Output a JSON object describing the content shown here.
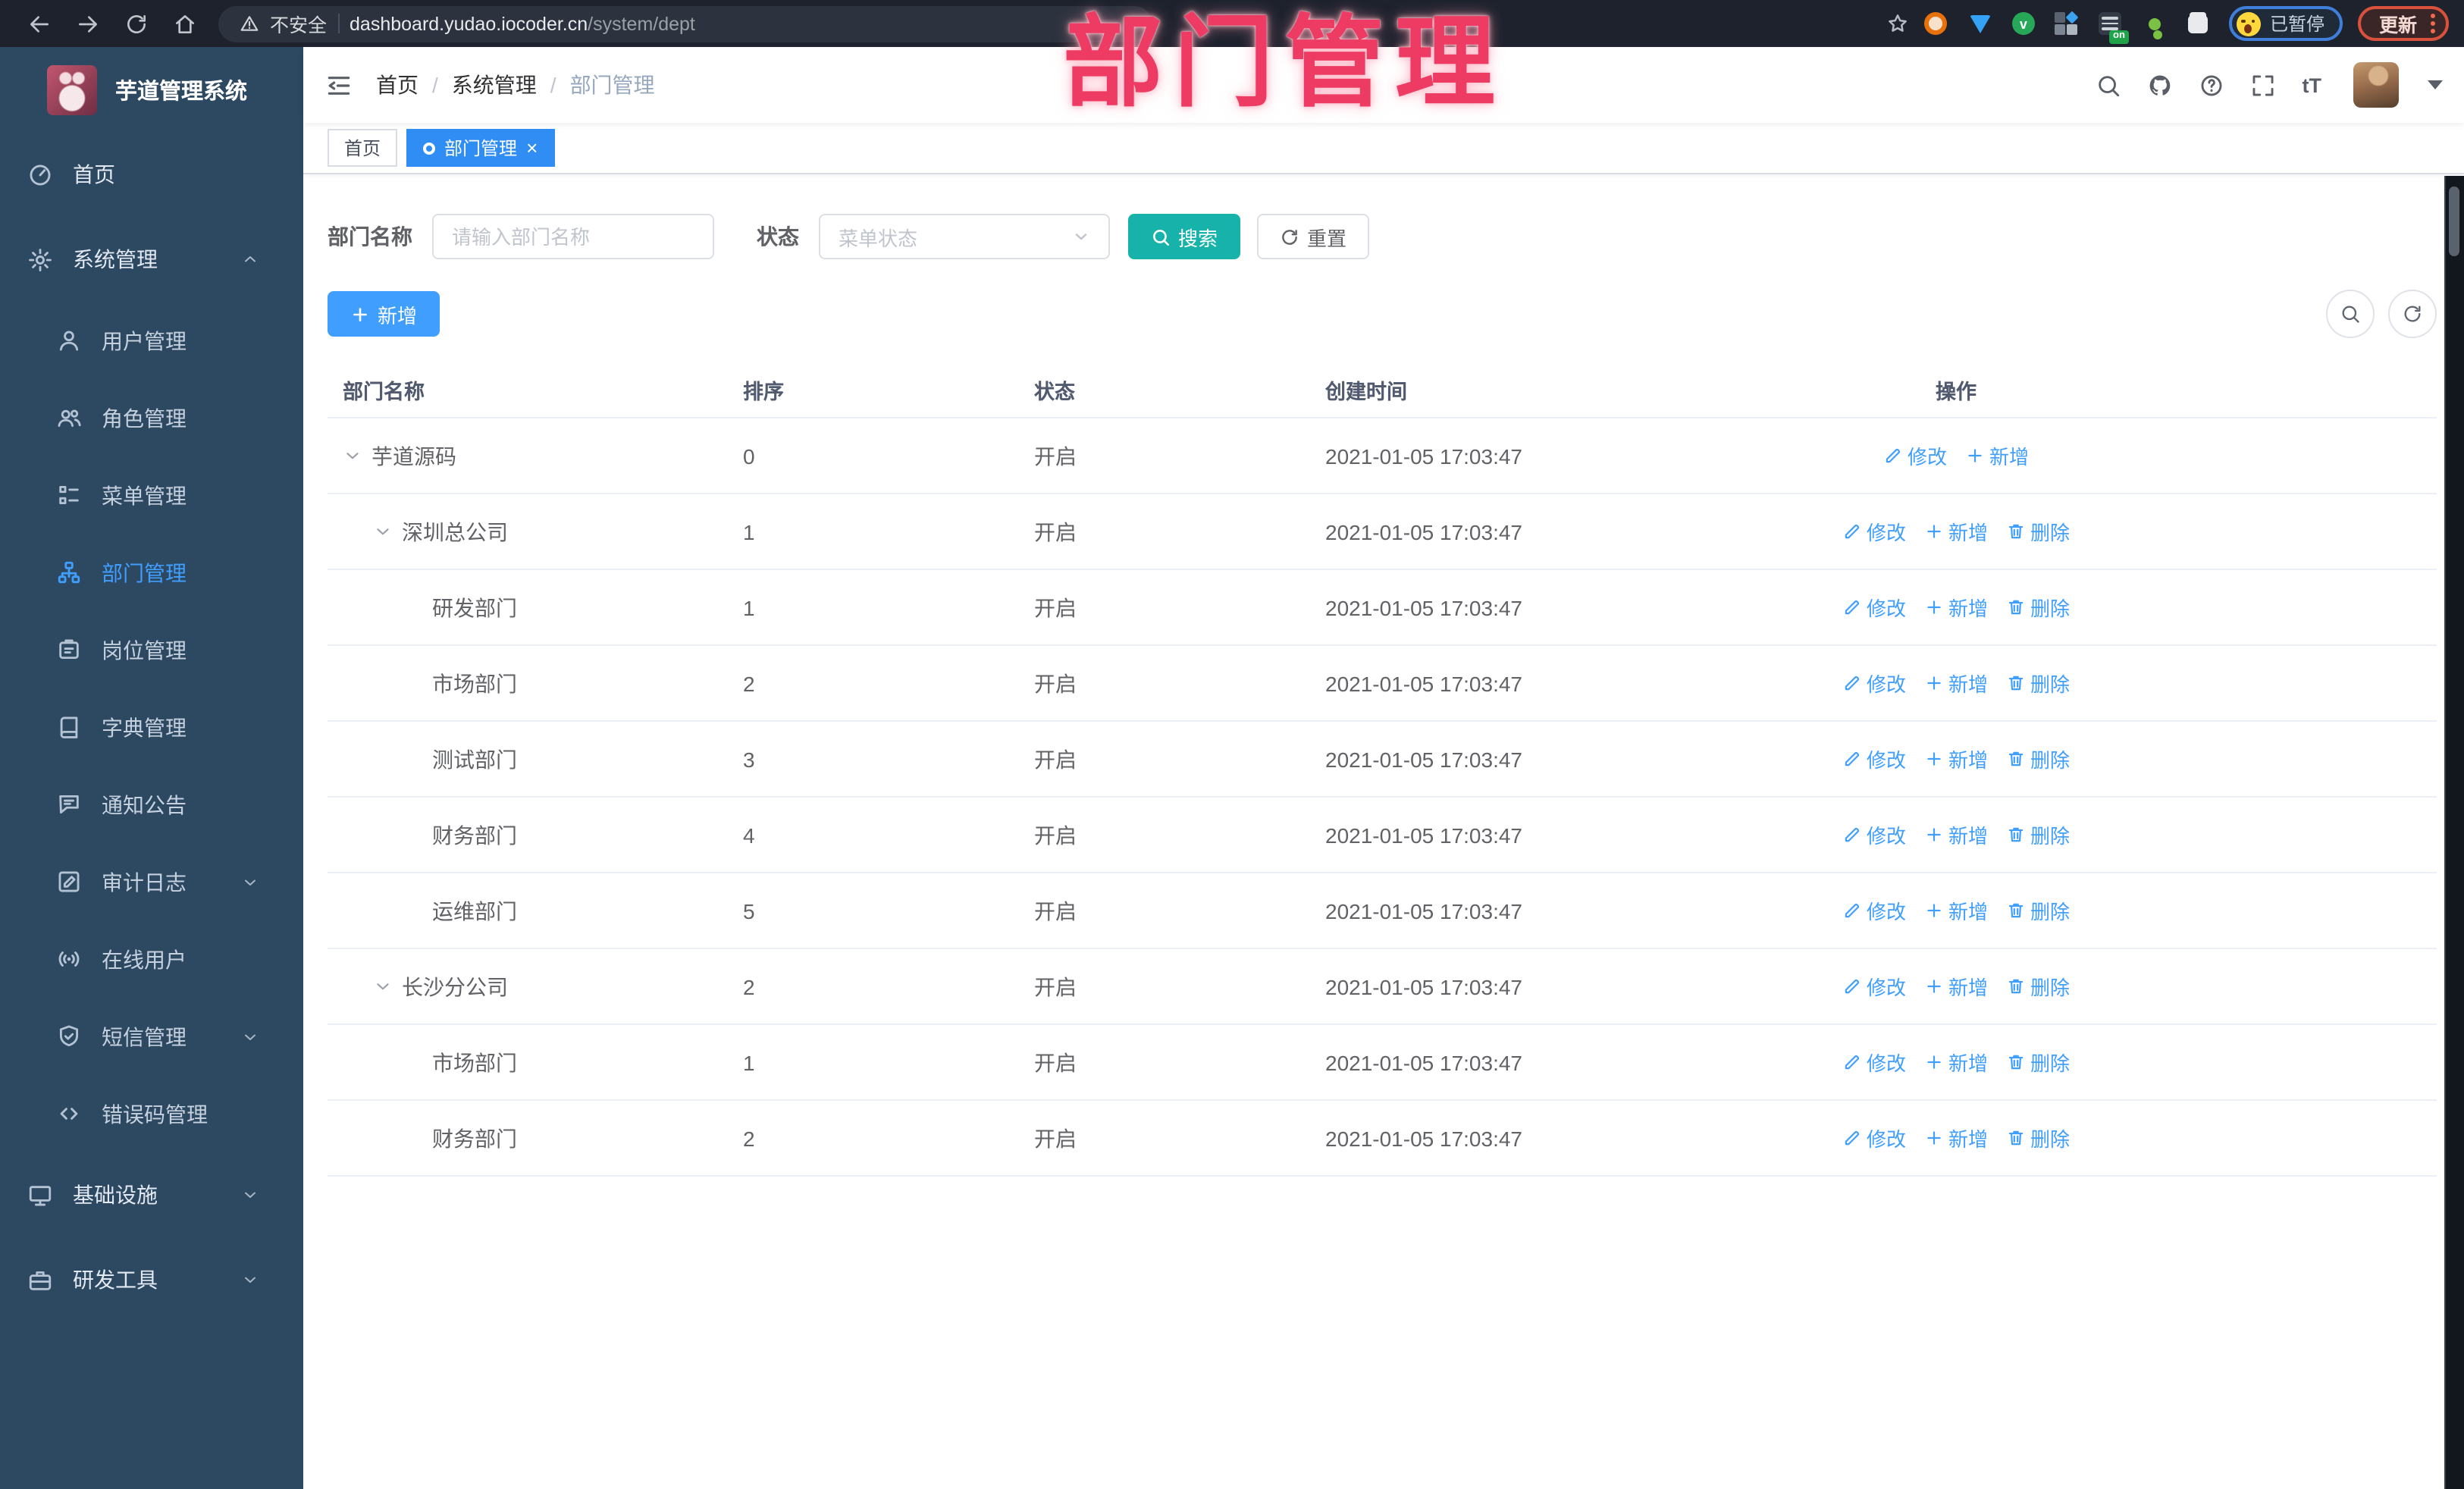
{
  "colors": {
    "accent": "#409eff",
    "teal": "#17b3ab",
    "pink": "#ee3b63",
    "side_bg": "#2d4861",
    "side_sub_bg": "#21364f",
    "chrome_bg": "#1d222d",
    "tab_blue": "#2f8df4"
  },
  "watermark": "部门管理",
  "browser": {
    "secure_label": "不安全",
    "url_host": "dashboard.yudao.iocoder.cn",
    "url_path": "/system/dept",
    "extension_on_badge": "on",
    "paused_badge": "已暂停",
    "update_button": "更新"
  },
  "sidebar": {
    "title": "芋道管理系统",
    "menu": [
      {
        "key": "home",
        "label": "首页",
        "icon": "dashboard-icon",
        "type": "top"
      },
      {
        "key": "system",
        "label": "系统管理",
        "icon": "gear-icon",
        "type": "top",
        "arrow": "up"
      },
      {
        "key": "user",
        "label": "用户管理",
        "icon": "user-icon",
        "type": "sub"
      },
      {
        "key": "role",
        "label": "角色管理",
        "icon": "users-icon",
        "type": "sub"
      },
      {
        "key": "menu",
        "label": "菜单管理",
        "icon": "menu-tree-icon",
        "type": "sub"
      },
      {
        "key": "dept",
        "label": "部门管理",
        "icon": "org-icon",
        "type": "sub",
        "active": true
      },
      {
        "key": "post",
        "label": "岗位管理",
        "icon": "badge-icon",
        "type": "sub"
      },
      {
        "key": "dict",
        "label": "字典管理",
        "icon": "book-icon",
        "type": "sub"
      },
      {
        "key": "notice",
        "label": "通知公告",
        "icon": "announce-icon",
        "type": "sub"
      },
      {
        "key": "audit-log",
        "label": "审计日志",
        "icon": "log-icon",
        "type": "sub",
        "arrow": "down"
      },
      {
        "key": "online-user",
        "label": "在线用户",
        "icon": "online-icon",
        "type": "sub"
      },
      {
        "key": "sms",
        "label": "短信管理",
        "icon": "sms-shield-icon",
        "type": "sub",
        "arrow": "down"
      },
      {
        "key": "error-code",
        "label": "错误码管理",
        "icon": "code-icon",
        "type": "sub"
      },
      {
        "key": "infra",
        "label": "基础设施",
        "icon": "monitor-icon",
        "type": "top",
        "arrow": "down"
      },
      {
        "key": "dev-tools",
        "label": "研发工具",
        "icon": "toolbox-icon",
        "type": "top",
        "arrow": "down"
      }
    ]
  },
  "header": {
    "breadcrumb": [
      "首页",
      "系统管理",
      "部门管理"
    ],
    "tabs": [
      {
        "key": "home",
        "label": "首页",
        "active": false,
        "closable": false
      },
      {
        "key": "dept",
        "label": "部门管理",
        "active": true,
        "closable": true
      }
    ]
  },
  "toolbar": {
    "dept_name_label": "部门名称",
    "dept_name_placeholder": "请输入部门名称",
    "status_label": "状态",
    "status_placeholder": "菜单状态",
    "search_label": "搜索",
    "reset_label": "重置",
    "add_label": "新增"
  },
  "table": {
    "columns": [
      "部门名称",
      "排序",
      "状态",
      "创建时间",
      "操作"
    ],
    "action_labels": {
      "modify": "修改",
      "add": "新增",
      "delete": "删除"
    },
    "rows": [
      {
        "name": "芋道源码",
        "level": 0,
        "expandable": true,
        "sort": "0",
        "status": "开启",
        "time": "2021-01-05 17:03:47",
        "actions": [
          "modify",
          "add"
        ]
      },
      {
        "name": "深圳总公司",
        "level": 1,
        "expandable": true,
        "sort": "1",
        "status": "开启",
        "time": "2021-01-05 17:03:47",
        "actions": [
          "modify",
          "add",
          "delete"
        ]
      },
      {
        "name": "研发部门",
        "level": 2,
        "expandable": false,
        "sort": "1",
        "status": "开启",
        "time": "2021-01-05 17:03:47",
        "actions": [
          "modify",
          "add",
          "delete"
        ]
      },
      {
        "name": "市场部门",
        "level": 2,
        "expandable": false,
        "sort": "2",
        "status": "开启",
        "time": "2021-01-05 17:03:47",
        "actions": [
          "modify",
          "add",
          "delete"
        ]
      },
      {
        "name": "测试部门",
        "level": 2,
        "expandable": false,
        "sort": "3",
        "status": "开启",
        "time": "2021-01-05 17:03:47",
        "actions": [
          "modify",
          "add",
          "delete"
        ]
      },
      {
        "name": "财务部门",
        "level": 2,
        "expandable": false,
        "sort": "4",
        "status": "开启",
        "time": "2021-01-05 17:03:47",
        "actions": [
          "modify",
          "add",
          "delete"
        ]
      },
      {
        "name": "运维部门",
        "level": 2,
        "expandable": false,
        "sort": "5",
        "status": "开启",
        "time": "2021-01-05 17:03:47",
        "actions": [
          "modify",
          "add",
          "delete"
        ]
      },
      {
        "name": "长沙分公司",
        "level": 1,
        "expandable": true,
        "sort": "2",
        "status": "开启",
        "time": "2021-01-05 17:03:47",
        "actions": [
          "modify",
          "add",
          "delete"
        ]
      },
      {
        "name": "市场部门",
        "level": 2,
        "expandable": false,
        "sort": "1",
        "status": "开启",
        "time": "2021-01-05 17:03:47",
        "actions": [
          "modify",
          "add",
          "delete"
        ]
      },
      {
        "name": "财务部门",
        "level": 2,
        "expandable": false,
        "sort": "2",
        "status": "开启",
        "time": "2021-01-05 17:03:47",
        "actions": [
          "modify",
          "add",
          "delete"
        ]
      }
    ]
  }
}
